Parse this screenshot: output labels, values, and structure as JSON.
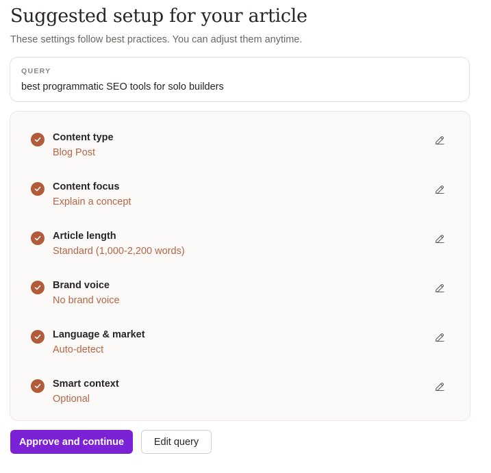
{
  "header": {
    "title": "Suggested setup for your article",
    "subtitle": "These settings follow best practices. You can adjust them anytime."
  },
  "query": {
    "label": "QUERY",
    "value": "best programmatic SEO tools for solo builders"
  },
  "settings": [
    {
      "title": "Content type",
      "value": "Blog Post",
      "status_icon": "check-icon",
      "edit_icon": "pencil-icon"
    },
    {
      "title": "Content focus",
      "value": "Explain a concept",
      "status_icon": "check-icon",
      "edit_icon": "pencil-icon"
    },
    {
      "title": "Article length",
      "value": "Standard (1,000-2,200 words)",
      "status_icon": "check-icon",
      "edit_icon": "pencil-icon"
    },
    {
      "title": "Brand voice",
      "value": "No brand voice",
      "status_icon": "check-icon",
      "edit_icon": "pencil-icon"
    },
    {
      "title": "Language & market",
      "value": "Auto-detect",
      "status_icon": "check-icon",
      "edit_icon": "pencil-icon"
    },
    {
      "title": "Smart context",
      "value": "Optional",
      "status_icon": "check-icon",
      "edit_icon": "pencil-icon"
    }
  ],
  "actions": {
    "approve_label": "Approve and continue",
    "edit_query_label": "Edit query"
  },
  "colors": {
    "accent_purple": "#7b22d6",
    "check_fill": "#b25b3a",
    "value_text": "#b86442"
  }
}
